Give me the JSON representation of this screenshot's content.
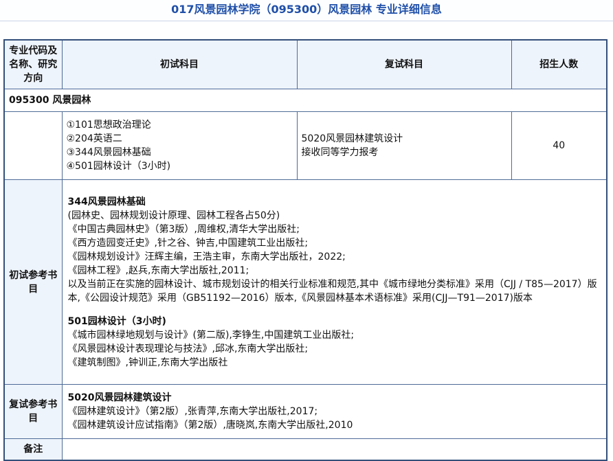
{
  "page": {
    "title": "017风景园林学院（095300）风景园林 专业详细信息"
  },
  "table": {
    "headers": {
      "code": "专业代码及名称、研究方向",
      "first_exam": "初试科目",
      "second_exam": "复试科目",
      "enroll": "招生人数"
    },
    "major": "095300 风景园林",
    "first_subjects": [
      "①101思想政治理论",
      "②204英语二",
      "③344风景园林基础",
      "④501园林设计（3小时)"
    ],
    "second_subjects": [
      "5020风景园林建筑设计",
      "接收同等学力报考"
    ],
    "enroll_count": "40",
    "first_ref_label": "初试参考书目",
    "first_ref": {
      "block1_title": "344风景园林基础",
      "block1_lines": [
        "(园林史、园林规划设计原理、园林工程各占50分)",
        "《中国古典园林史》（第3版）,周维权,清华大学出版社;",
        "《西方造园变迁史》,针之谷、钟吉,中国建筑工业出版社;",
        "《园林规划设计》汪辉主编，王浩主审，东南大学出版社，2022;",
        "《园林工程》,赵兵,东南大学出版社,2011;",
        "以及当前正在实施的园林设计、城市规划设计的相关行业标准和规范,其中《城市绿地分类标准》采用（CJJ / T85—2017）版本,《公园设计规范》采用（GB51192—2016）版本,《风景园林基本术语标准》采用(CJJ—T91—2017)版本"
      ],
      "block2_title": "501园林设计（3小时)",
      "block2_lines": [
        "《城市园林绿地规划与设计》(第二版),李铮生,中国建筑工业出版社;",
        "《风景园林设计表现理论与技法》,邱冰,东南大学出版社;",
        "《建筑制图》,钟训正,东南大学出版社"
      ]
    },
    "second_ref_label": "复试参考书目",
    "second_ref": {
      "title": "5020风景园林建筑设计",
      "lines": [
        "《园林建筑设计》（第2版）,张青萍,东南大学出版社,2017;",
        "《园林建筑设计应试指南》（第2版）,唐晓岚,东南大学出版社,2010"
      ]
    },
    "note_label": "备注",
    "note_value": ""
  }
}
